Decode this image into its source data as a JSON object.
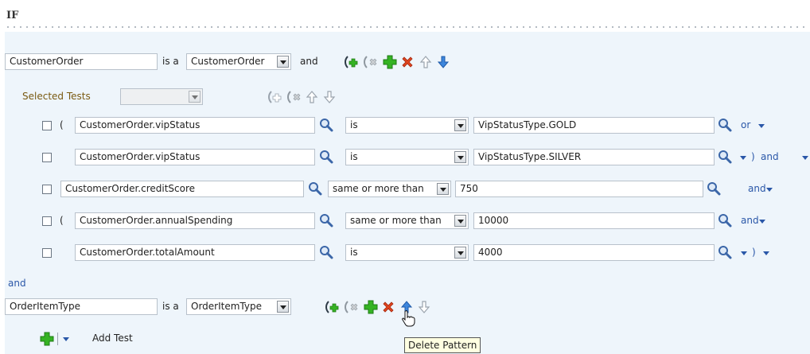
{
  "header": {
    "if_label": "IF"
  },
  "pattern1": {
    "alias": "CustomerOrder",
    "is_a_label": "is a",
    "fact_type": "CustomerOrder",
    "connector": "and"
  },
  "selected_tests": {
    "label": "Selected Tests",
    "value": ""
  },
  "tests": [
    {
      "open_paren": "(",
      "field": "CustomerOrder.vipStatus",
      "operator": "is",
      "value": "VipStatusType.GOLD",
      "connector": "or",
      "close_paren": ""
    },
    {
      "open_paren": "",
      "field": "CustomerOrder.vipStatus",
      "operator": "is",
      "value": "VipStatusType.SILVER",
      "connector": "and",
      "close_paren": ")"
    },
    {
      "open_paren": "",
      "field": "CustomerOrder.creditScore",
      "operator": "same or more than",
      "value": "750",
      "connector": "and",
      "close_paren": ""
    },
    {
      "open_paren": "(",
      "field": "CustomerOrder.annualSpending",
      "operator": "same or more than",
      "value": "10000",
      "connector": "and",
      "close_paren": ""
    },
    {
      "open_paren": "",
      "field": "CustomerOrder.totalAmount",
      "operator": "is",
      "value": "4000",
      "connector": "",
      "close_paren": ")"
    }
  ],
  "between_label": "and",
  "pattern2": {
    "alias": "OrderItemType",
    "is_a_label": "is a",
    "fact_type": "OrderItemType"
  },
  "add_test": {
    "label": "Add Test"
  },
  "tooltip": {
    "text": "Delete Pattern"
  },
  "colors": {
    "panel_bg": "#eef5fb",
    "link": "#2a57a8",
    "add_green": "#2fa71f",
    "delete_red": "#d33a1f",
    "arrow_blue": "#2f73c9"
  }
}
